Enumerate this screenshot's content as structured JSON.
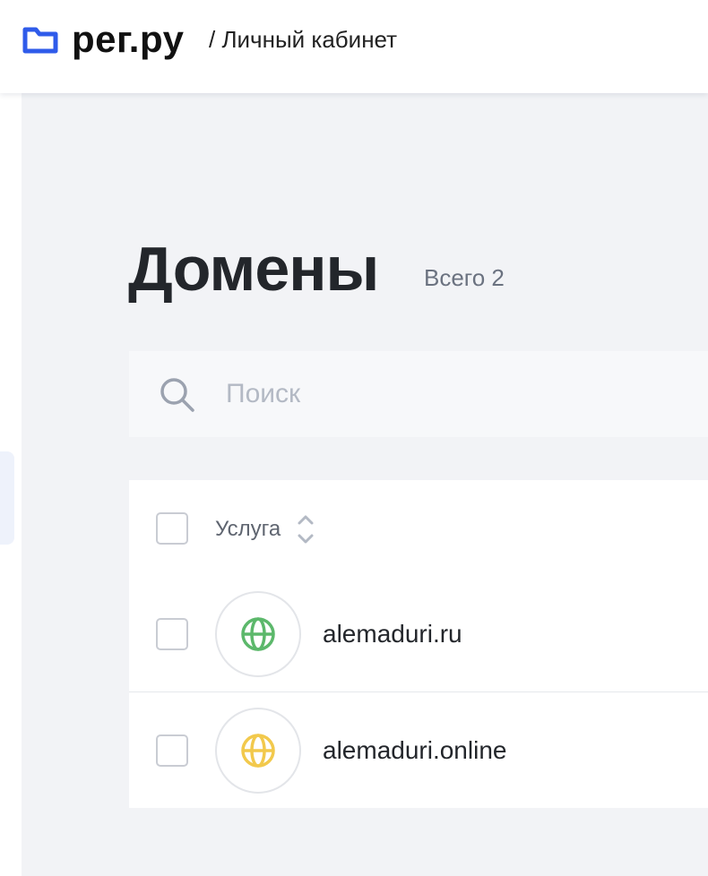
{
  "header": {
    "logo_text": "рег.ру",
    "breadcrumb": "/ Личный кабинет",
    "accent_color": "#2f5bea"
  },
  "page": {
    "title": "Домены",
    "total_label": "Всего 2"
  },
  "search": {
    "placeholder": "Поиск"
  },
  "table": {
    "column_service": "Услуга",
    "rows": [
      {
        "domain": "alemaduri.ru",
        "icon": "globe-icon",
        "icon_color": "#5cb86b"
      },
      {
        "domain": "alemaduri.online",
        "icon": "globe-icon",
        "icon_color": "#f2c94c"
      }
    ]
  }
}
